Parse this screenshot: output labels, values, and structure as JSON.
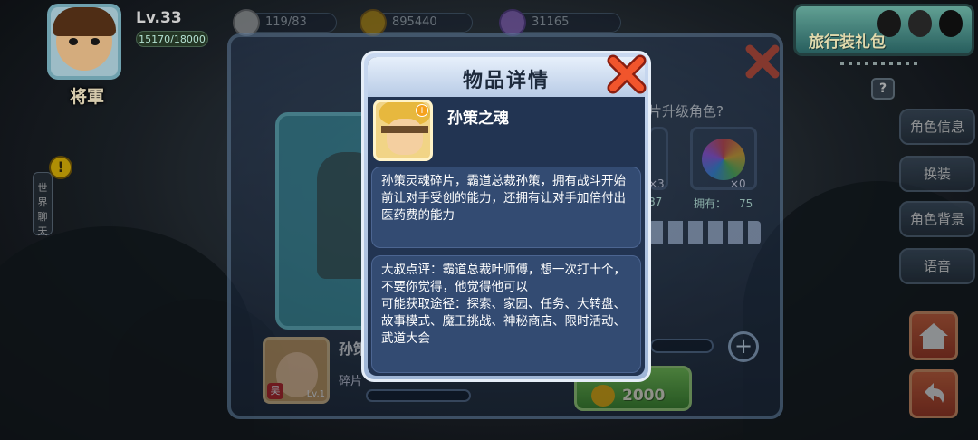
{
  "player": {
    "level": "Lv.33",
    "exp": "15170/18000",
    "rank": "将軍",
    "energy": "119/83",
    "coins": "895440",
    "gems": "31165"
  },
  "gift_pack": {
    "label": "旅行装礼包"
  },
  "side_menu": [
    "角色信息",
    "换装",
    "角色背景",
    "语音"
  ],
  "help_label": "?",
  "world_chat_label": "世界聊天",
  "panel": {
    "question": "片升级角色?",
    "owned_label": "拥有：",
    "owned_value": "75",
    "slot_left_count": "×3",
    "slot_left_partial": "87",
    "slot_right_count": "×0",
    "hero_name_partial": "孙策",
    "fragment_label": "碎片",
    "mini_level": "Lv.1",
    "mini_badge": "吴",
    "buy_price": "2000"
  },
  "modal": {
    "title": "物品详情",
    "item_name": "孙策之魂",
    "description": "孙策灵魂碎片，霸道总裁孙策，拥有战斗开始前让对手受创的能力，还拥有让对手加倍付出医药费的能力",
    "comment": "大叔点评：霸道总裁叶师傅，想一次打十个，不要你觉得，他觉得他可以",
    "sources": "可能获取途径：探索、家园、任务、大转盘、故事模式、魔王挑战、神秘商店、限时活动、武道大会"
  },
  "colors": {
    "accent_green": "#7bd44d",
    "close_red": "#e53a2a",
    "panel_blue": "#223452"
  }
}
